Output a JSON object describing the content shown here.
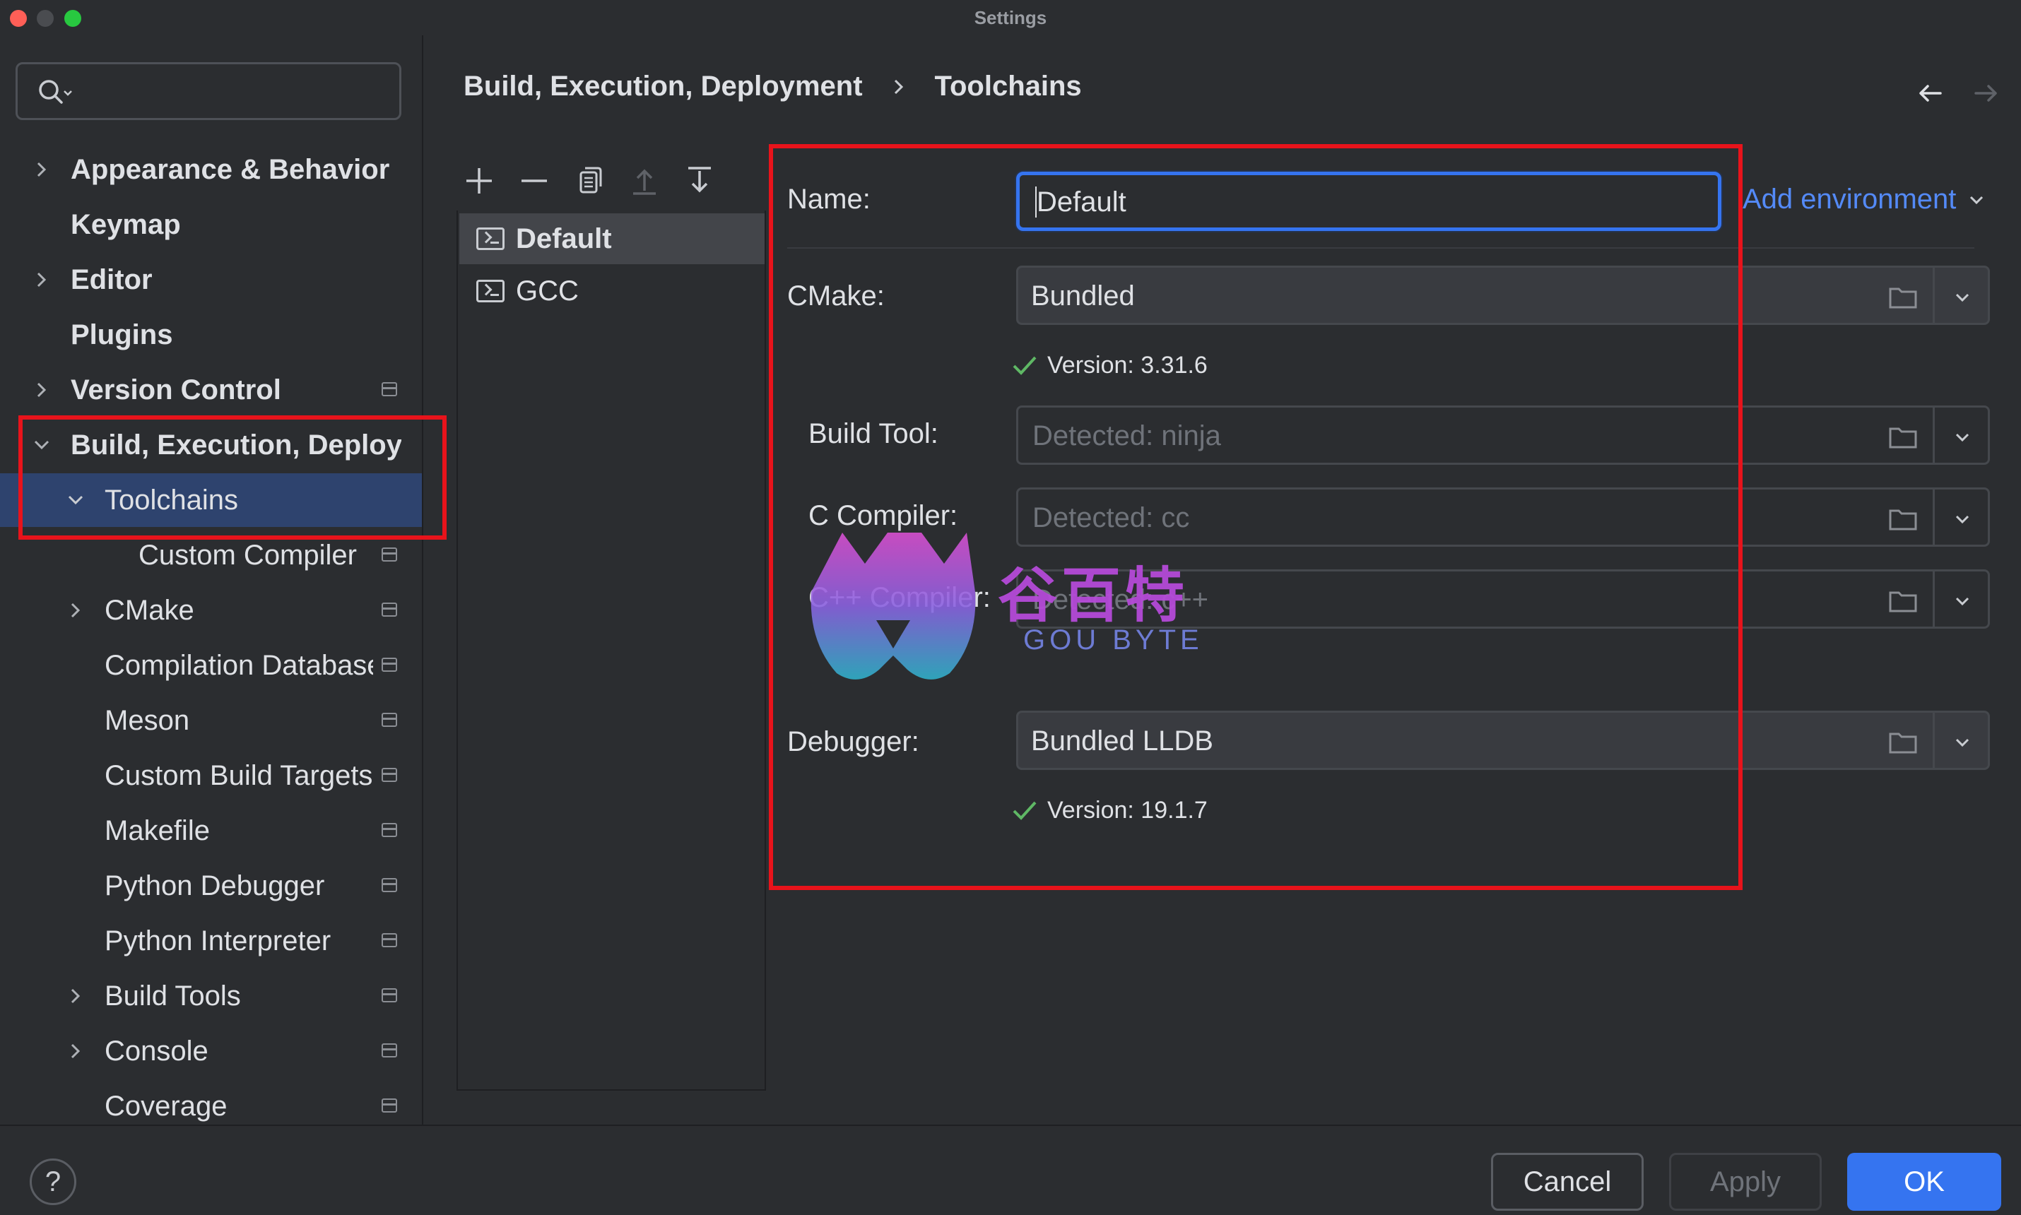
{
  "window": {
    "title": "Settings"
  },
  "search": {
    "placeholder": ""
  },
  "sidebar": {
    "items": [
      {
        "label": "Appearance & Behavior"
      },
      {
        "label": "Keymap"
      },
      {
        "label": "Editor"
      },
      {
        "label": "Plugins"
      },
      {
        "label": "Version Control"
      },
      {
        "label": "Build, Execution, Deployment"
      },
      {
        "label": "Toolchains"
      },
      {
        "label": "Custom Compiler"
      },
      {
        "label": "CMake"
      },
      {
        "label": "Compilation Database"
      },
      {
        "label": "Meson"
      },
      {
        "label": "Custom Build Targets"
      },
      {
        "label": "Makefile"
      },
      {
        "label": "Python Debugger"
      },
      {
        "label": "Python Interpreter"
      },
      {
        "label": "Build Tools"
      },
      {
        "label": "Console"
      },
      {
        "label": "Coverage"
      }
    ]
  },
  "breadcrumb": {
    "parent": "Build, Execution, Deployment",
    "current": "Toolchains"
  },
  "toolchains": {
    "items": [
      {
        "label": "Default"
      },
      {
        "label": "GCC"
      }
    ]
  },
  "details": {
    "name_label": "Name:",
    "name_value": "Default",
    "add_environment": "Add environment",
    "cmake_label": "CMake:",
    "cmake_value": "Bundled",
    "cmake_version": "Version: 3.31.6",
    "build_tool_label": "Build Tool:",
    "build_tool_placeholder": "Detected: ninja",
    "c_compiler_label": "C Compiler:",
    "c_compiler_placeholder": "Detected: cc",
    "cpp_compiler_label": "C++ Compiler:",
    "cpp_compiler_placeholder": "Detected: c++",
    "debugger_label": "Debugger:",
    "debugger_value": "Bundled LLDB",
    "debugger_version": "Version: 19.1.7"
  },
  "watermark": {
    "cn": "谷百特",
    "en": "GOU BYTE"
  },
  "footer": {
    "help": "?",
    "cancel": "Cancel",
    "apply": "Apply",
    "ok": "OK"
  },
  "colors": {
    "accent": "#3574f0",
    "link": "#548af7",
    "highlight_box": "#e8131b",
    "selection": "#2e436e",
    "check": "#5fb865"
  }
}
